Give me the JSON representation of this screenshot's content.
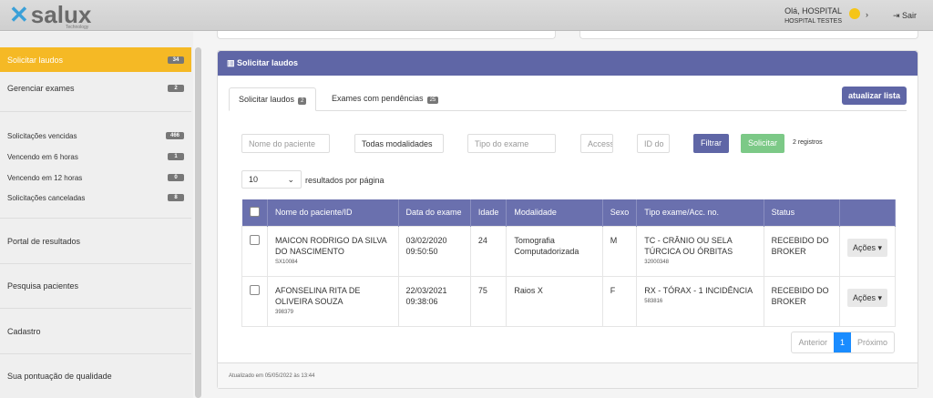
{
  "header": {
    "logo": "salux",
    "logo_sub": "Technology",
    "greeting": "Olá, HOSPITAL",
    "hospital": "HOSPITAL TESTES",
    "logout": "Sair"
  },
  "sidebar": {
    "items": [
      {
        "label": "Solicitar laudos",
        "badge": "34"
      },
      {
        "label": "Gerenciar exames",
        "badge": "2"
      },
      {
        "label": "Solicitações vencidas",
        "badge": "466"
      },
      {
        "label": "Vencendo em 6 horas",
        "badge": "1"
      },
      {
        "label": "Vencendo em 12 horas",
        "badge": "0"
      },
      {
        "label": "Solicitações canceladas",
        "badge": "8"
      },
      {
        "label": "Portal de resultados"
      },
      {
        "label": "Pesquisa pacientes"
      },
      {
        "label": "Cadastro"
      },
      {
        "label": "Sua pontuação de qualidade"
      }
    ]
  },
  "panel": {
    "title": "Solicitar laudos",
    "tabs": [
      {
        "label": "Solicitar laudos",
        "badge": "2"
      },
      {
        "label": "Exames com pendências",
        "badge": "25"
      }
    ],
    "refresh": "atualizar lista",
    "filters": {
      "name_ph": "Nome do paciente",
      "modality": "Todas modalidades",
      "exam_ph": "Tipo do exame",
      "acc_ph": "Accession",
      "id_ph": "ID do",
      "filter": "Filtrar",
      "request": "Solicitar",
      "count": "2 registros"
    },
    "per_page": "10",
    "per_page_label": "resultados por página",
    "columns": [
      "Nome do paciente/ID",
      "Data do exame",
      "Idade",
      "Modalidade",
      "Sexo",
      "Tipo exame/Acc. no.",
      "Status"
    ],
    "rows": [
      {
        "name": "MAICON RODRIGO DA SILVA DO NASCIMENTO",
        "id": "SX10084",
        "date": "03/02/2020",
        "time": "09:50:50",
        "age": "24",
        "modality": "Tomografia Computadorizada",
        "sex": "M",
        "exam": "TC - CRÂNIO OU SELA TÚRCICA OU ÓRBITAS",
        "acc": "32000348",
        "status": "RECEBIDO DO BROKER",
        "action": "Ações ▾"
      },
      {
        "name": "AFONSELINA RITA DE OLIVEIRA SOUZA",
        "id": "398379",
        "date": "22/03/2021",
        "time": "09:38:06",
        "age": "75",
        "modality": "Raios X",
        "sex": "F",
        "exam": "RX - TÓRAX - 1 INCIDÊNCIA",
        "acc": "583816",
        "status": "RECEBIDO DO BROKER",
        "action": "Ações ▾"
      }
    ],
    "pagination": {
      "prev": "Anterior",
      "page": "1",
      "next": "Próximo"
    },
    "footer": "Atualizado em 05/05/2022 às 13:44"
  },
  "colors": {
    "accent": "#5f66a6",
    "active": "#f5b925"
  }
}
